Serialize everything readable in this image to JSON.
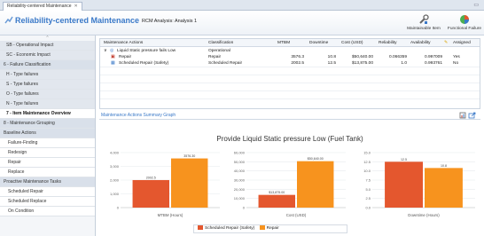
{
  "tab": {
    "label": "Reliability-centered Maintenance"
  },
  "header": {
    "title": "Reliability-centered Maintenance",
    "analysis": "RCM Analysis: Analysis 1"
  },
  "toolbar": [
    {
      "label": "Maintainable Item",
      "icon": "wrench-icon"
    },
    {
      "label": "Functional Failure",
      "icon": "pie-chart-icon"
    }
  ],
  "sidebar": {
    "items": [
      {
        "label": "SB - Operational Impact",
        "kind": "cat"
      },
      {
        "label": "SC - Economic Impact",
        "kind": "cat"
      },
      {
        "label": "6 - Failure Classification",
        "kind": "hdr"
      },
      {
        "label": "H - Type failures",
        "kind": "cat"
      },
      {
        "label": "S - Type failures",
        "kind": "cat"
      },
      {
        "label": "O - Type failures",
        "kind": "cat"
      },
      {
        "label": "N - Type failures",
        "kind": "cat"
      },
      {
        "label": "7 - Item Maintenance Overview",
        "kind": "active"
      },
      {
        "label": "8 - Maintenance Grouping",
        "kind": "hdr"
      },
      {
        "label": "Baseline Actions",
        "kind": "hdr"
      },
      {
        "label": "Failure-Finding",
        "kind": "sub"
      },
      {
        "label": "Redesign",
        "kind": "sub"
      },
      {
        "label": "Repair",
        "kind": "sub"
      },
      {
        "label": "Replace",
        "kind": "sub"
      },
      {
        "label": "Proactive Maintenance Tasks",
        "kind": "hdr"
      },
      {
        "label": "Scheduled Repair",
        "kind": "sub"
      },
      {
        "label": "Scheduled Replace",
        "kind": "sub"
      },
      {
        "label": "On Condition",
        "kind": "sub"
      }
    ]
  },
  "grid": {
    "columns": [
      "Maintenance Actions",
      "Classification",
      "MTBM",
      "Downtime",
      "Cost (USD)",
      "Reliability",
      "Availability",
      "Assigned"
    ],
    "group": {
      "label": "Liquid Static pressure fails Low",
      "classification": "Operational"
    },
    "rows": [
      {
        "action": "Repair",
        "classification": "Repair",
        "mtbm": "3576.3",
        "downtime": "10.8",
        "cost": "$50,640.00",
        "reliability": "0.066359",
        "availability": "0.997009",
        "assigned": "Yes"
      },
      {
        "action": "Scheduled Repair (Safety)",
        "classification": "Scheduled Repair",
        "mtbm": "2002.5",
        "downtime": "12.5",
        "cost": "$13,875.00",
        "reliability": "1.0",
        "availability": "0.993761",
        "assigned": "No"
      }
    ]
  },
  "summary": {
    "title": "Maintenance Actions Summary Graph"
  },
  "colors": {
    "scheduled": "#e4572e",
    "repair": "#f7931e",
    "accent": "#3a79c8"
  },
  "chart_data": {
    "type": "bar",
    "title": "Provide Liquid Static pressure Low (Fuel Tank)",
    "series": [
      {
        "name": "Scheduled Repair (Safety)",
        "color": "#e4572e"
      },
      {
        "name": "Repair",
        "color": "#f7931e"
      }
    ],
    "panels": [
      {
        "xlabel": "MTBM (Hours)",
        "values": [
          2002.5,
          3576.3
        ],
        "labels": [
          "2002.5",
          "3576.30"
        ],
        "ylim": [
          0,
          4000
        ],
        "ticks": [
          "0",
          "1,000",
          "2,000",
          "3,000",
          "4,000"
        ]
      },
      {
        "xlabel": "Cost (USD)",
        "values": [
          13875,
          50640
        ],
        "labels": [
          "$13,875.00",
          "$50,640.00"
        ],
        "ylim": [
          0,
          60000
        ],
        "ticks": [
          "0",
          "10,000",
          "20,000",
          "30,000",
          "40,000",
          "50,000",
          "60,000"
        ]
      },
      {
        "xlabel": "Downtime (Hours)",
        "values": [
          12.5,
          10.8
        ],
        "labels": [
          "12.5",
          "10.8"
        ],
        "ylim": [
          0,
          15
        ],
        "ticks": [
          "0.0",
          "2.5",
          "5.0",
          "7.5",
          "10.0",
          "12.5",
          "15.0"
        ]
      }
    ]
  }
}
